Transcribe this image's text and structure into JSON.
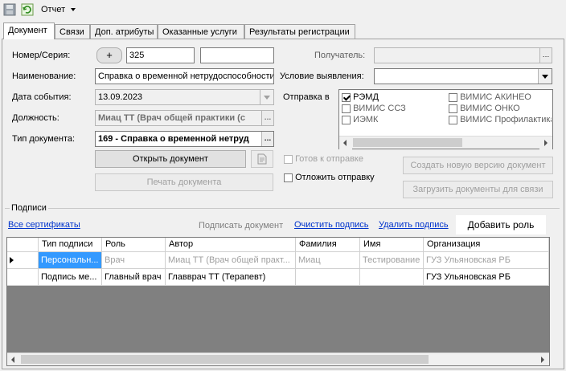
{
  "toolbar": {
    "report_label": "Отчет"
  },
  "tabs": [
    {
      "label": "Документ"
    },
    {
      "label": "Связи"
    },
    {
      "label": "Доп. атрибуты"
    },
    {
      "label": "Оказанные услуги"
    },
    {
      "label": "Результаты регистрации"
    }
  ],
  "form": {
    "number_label": "Номер/Серия:",
    "plus_label": "+",
    "number_value": "325",
    "series_value": "",
    "name_label": "Наименование:",
    "name_value": "Справка о временной нетрудоспособности",
    "date_label": "Дата события:",
    "date_value": "13.09.2023",
    "position_label": "Должность:",
    "position_value": "Миац ТТ (Врач общей практики (с",
    "doctype_label": "Тип документа:",
    "doctype_value": "169 - Справка о временной нетруд",
    "open_doc_button": "Открыть документ",
    "print_doc_button": "Печать документа",
    "recipient_label": "Получатель:",
    "recipient_value": "",
    "condition_label": "Условие выявления:",
    "condition_value": "",
    "send_to_label": "Отправка в",
    "send_targets": [
      {
        "label": "РЭМД",
        "checked": true
      },
      {
        "label": "ВИМИС АКИНЕО",
        "checked": false
      },
      {
        "label": "ВИМИС ССЗ",
        "checked": false
      },
      {
        "label": "ВИМИС ОНКО",
        "checked": false
      },
      {
        "label": "ИЭМК",
        "checked": false
      },
      {
        "label": "ВИМИС Профилактика",
        "checked": false
      }
    ],
    "ready_to_send_label": "Готов к отправке",
    "postpone_send_label": "Отложить отправку",
    "create_version_button": "Создать новую версию документ",
    "load_docs_button": "Загрузить документы для связи"
  },
  "signatures": {
    "group_title": "Подписи",
    "all_certs_link": "Все сертификаты",
    "sign_doc_label": "Подписать документ",
    "clear_sign_link": "Очистить подпись",
    "delete_sign_link": "Удалить подпись",
    "add_role_button": "Добавить роль",
    "columns": [
      "Тип подписи",
      "Роль",
      "Автор",
      "Фамилия",
      "Имя",
      "Организация"
    ],
    "rows": [
      {
        "type": "Персональн...",
        "role": "Врач",
        "author": "Миац ТТ (Врач общей практ...",
        "lastname": "Миац",
        "firstname": "Тестирование",
        "org": "ГУЗ Ульяновская РБ"
      },
      {
        "type": "Подпись ме...",
        "role": "Главный врач",
        "author": "Главврач ТТ (Терапевт)",
        "lastname": "",
        "firstname": "",
        "org": "ГУЗ Ульяновская РБ"
      }
    ]
  }
}
